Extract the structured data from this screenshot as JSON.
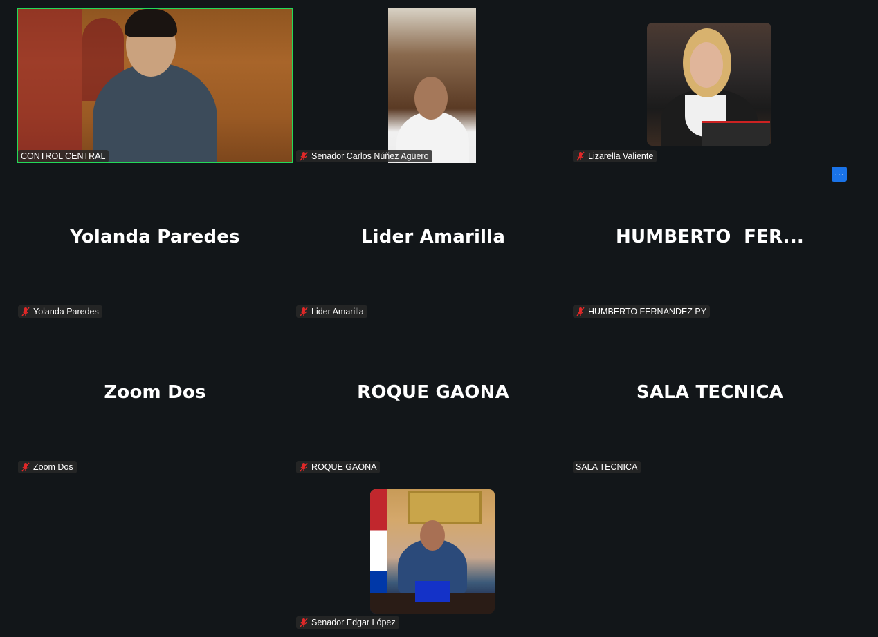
{
  "participants": [
    {
      "id": "p1",
      "display_name": "",
      "label": "CONTROL CENTRAL",
      "muted": false,
      "active_speaker": true,
      "video": true
    },
    {
      "id": "p2",
      "display_name": "",
      "label": "Senador Carlos Núñez Agüero",
      "muted": true,
      "video": true
    },
    {
      "id": "p3",
      "display_name": "",
      "label": "Lizarella Valiente",
      "muted": true,
      "video": true
    },
    {
      "id": "p4",
      "display_name": "Yolanda Paredes",
      "label": "Yolanda Paredes",
      "muted": true,
      "video": false
    },
    {
      "id": "p5",
      "display_name": "Lider Amarilla",
      "label": "Lider Amarilla",
      "muted": true,
      "video": false
    },
    {
      "id": "p6",
      "display_name": "HUMBERTO  FER...",
      "label": "HUMBERTO FERNANDEZ PY",
      "muted": true,
      "video": false
    },
    {
      "id": "p7",
      "display_name": "Zoom Dos",
      "label": "Zoom Dos",
      "muted": true,
      "video": false
    },
    {
      "id": "p8",
      "display_name": "ROQUE GAONA",
      "label": "ROQUE GAONA",
      "muted": true,
      "video": false
    },
    {
      "id": "p9",
      "display_name": "SALA TECNICA",
      "label": "SALA TECNICA",
      "muted": false,
      "video": false
    },
    {
      "id": "p10",
      "display_name": "",
      "label": "Senador Edgar López",
      "muted": true,
      "video": true
    }
  ],
  "more_options": {
    "label": "···"
  },
  "colors": {
    "background": "#121619",
    "active_border": "#23d959",
    "mute_red": "#e02828",
    "more_button": "#1a73e8"
  },
  "icons": {
    "mute": "muted-microphone-icon",
    "more": "more-options-icon"
  }
}
